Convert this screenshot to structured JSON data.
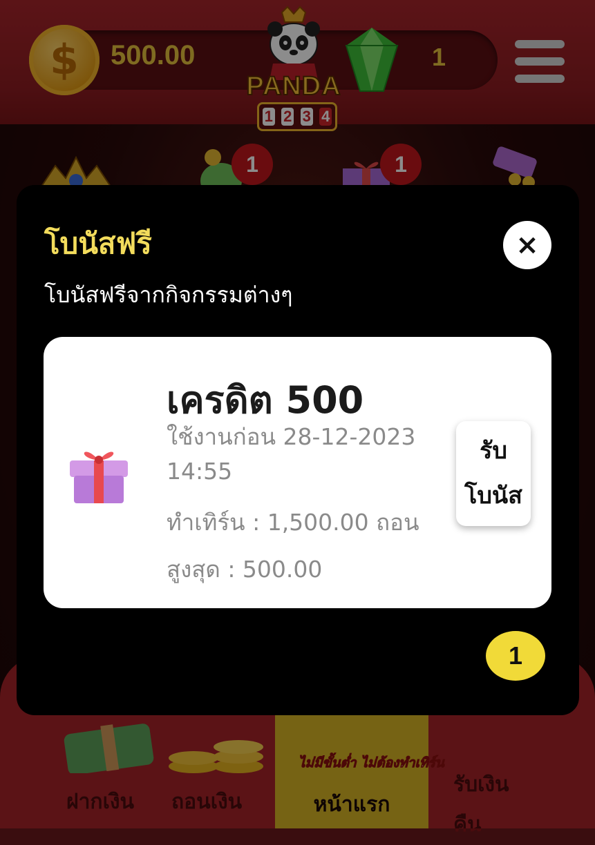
{
  "header": {
    "balance": "500.00",
    "gem_count": "1",
    "logo_text": "PANDA",
    "logo_digits": [
      "1",
      "2",
      "3",
      "4"
    ]
  },
  "background": {
    "badges": [
      "1",
      "1"
    ],
    "nav": {
      "deposit": "ฝากเงิน",
      "withdraw": "ถอนเงิน",
      "home": "หน้าแรก",
      "cashback": "รับเงินคืน",
      "promo_text": "ไม่มีขั้นต่ำ ไม่ต้องทำเทิร์น"
    }
  },
  "modal": {
    "title": "โบนัสฟรี",
    "subtitle": "โบนัสฟรีจากกิจกรรมต่างๆ",
    "close_label": "×",
    "card": {
      "title": "เครดิต 500",
      "expiry_line1": "ใช้งานก่อน 28-12-2023",
      "expiry_line2": "14:55",
      "turnover": "ทำเทิร์น : 1,500.00  ถอน",
      "max": "สูงสุด : 500.00",
      "claim_line1": "รับ",
      "claim_line2": "โบนัส"
    },
    "page_badge": "1"
  },
  "colors": {
    "header_red": "#a7252b",
    "accent_gold": "#e8c33d",
    "title_yellow": "#f3dc5c",
    "badge_yellow": "#f1da38",
    "modal_bg": "#000000"
  }
}
